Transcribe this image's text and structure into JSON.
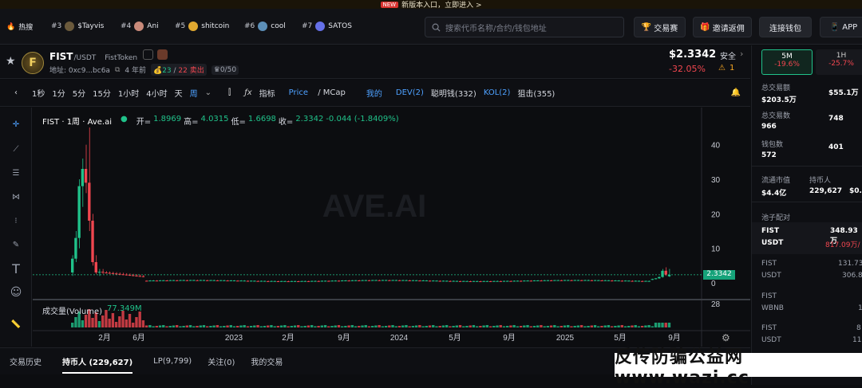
{
  "banner": {
    "new": "NEW",
    "text": "新版本入口，立即进入 >"
  },
  "hotbar": {
    "hot_label": "热搜",
    "items": [
      {
        "rank": "#3",
        "name": "$Tayvis"
      },
      {
        "rank": "#4",
        "name": "Ani"
      },
      {
        "rank": "#5",
        "name": "shitcoin"
      },
      {
        "rank": "#6",
        "name": "cool"
      },
      {
        "rank": "#7",
        "name": "SATOS"
      }
    ]
  },
  "search": {
    "placeholder": "搜索代币名称/合约/钱包地址"
  },
  "topbuttons": {
    "trade": "交易赛",
    "invite": "邀请返佣",
    "wallet": "连接钱包",
    "app": "APP"
  },
  "token": {
    "symbol": "FIST",
    "pair": "/USDT",
    "name": "FistToken",
    "address_label": "地址: 0xc9...bc6a",
    "age": "4 年前",
    "buys": "23",
    "sells": "22 卖出",
    "holders_ratio": "0/50",
    "price": "$2.3342",
    "change": "-32.05%",
    "security_label": "安全",
    "security_count": "1"
  },
  "toolbar": {
    "intervals": [
      "1秒",
      "1分",
      "5分",
      "15分",
      "1小时",
      "4小时",
      "天",
      "周"
    ],
    "active": "周",
    "indicator": "指标",
    "price": "Price",
    "mcap": "MCap",
    "mine": "我的",
    "dev": "DEV(2)",
    "smart": "聪明钱(332)",
    "kol": "KOL(2)",
    "snipe": "狙击(355)"
  },
  "chart_legend": {
    "title": "FIST · 1周 · Ave.ai",
    "open_label": "开=",
    "open": "1.8969",
    "high_label": "高=",
    "high": "4.0315",
    "low_label": "低=",
    "low": "1.6698",
    "close_label": "收=",
    "close": "2.3342",
    "change": "-0.044 (-1.8409%)",
    "watermark": "AVE.AI",
    "volume_label": "成交量(Volume)",
    "volume": "77.349M",
    "price_tag": "2.3342"
  },
  "chart_data": {
    "type": "candlestick",
    "title": "FIST · 1周 · Ave.ai",
    "ylim": [
      0,
      45
    ],
    "yticks": [
      0,
      10,
      20,
      30,
      40
    ],
    "volume_tick": "28",
    "xticks": [
      "2月",
      "6月",
      "2023",
      "2月",
      "9月",
      "2024",
      "5月",
      "9月",
      "2025",
      "5月",
      "9月"
    ],
    "last_close": 2.3342,
    "legend_ohlc": {
      "open": 1.8969,
      "high": 4.0315,
      "low": 1.6698,
      "close": 2.3342
    }
  },
  "bottom": {
    "tabs": [
      "交易历史",
      "持币人 (229,627)",
      "LP(9,799)",
      "关注(0)",
      "我的交易"
    ]
  },
  "right": {
    "tf1": "5M",
    "tf1_change": "-19.6%",
    "tf2": "1H",
    "tf2_change": "-25.7%",
    "total_volume_label": "总交易额",
    "total_volume": "$203.5万",
    "total_volume2": "$55.1万",
    "trades_label": "总交易数",
    "trades": "966",
    "trades2": "748",
    "wallets_label": "钱包数",
    "wallets": "572",
    "wallets2": "401",
    "mcap_label": "流通市值",
    "mcap": "$4.4亿",
    "holders_label": "持币人",
    "holders": "229,627",
    "extra": "$0.0",
    "pool_label": "池子配对",
    "pool1_a": "FIST",
    "pool1_a_val": "348.93万",
    "pool1_b": "USDT",
    "pool1_b_val": "817.09万/",
    "pool2_a": "FIST",
    "pool2_a_val": "131.73",
    "pool2_b": "USDT",
    "pool2_b_val": "306.8",
    "pool3_a": "FIST",
    "pool3_b": "WBNB",
    "pool3_b_val": "1",
    "pool4_a": "FIST",
    "pool4_a_val": "8",
    "pool4_b": "USDT",
    "pool4_b_val": "11"
  },
  "watermark": {
    "text": "反传防骗公益网 www.wazi.cc"
  }
}
